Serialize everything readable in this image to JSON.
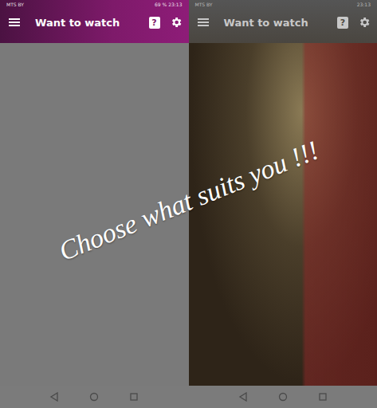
{
  "screens": [
    {
      "status_bar": {
        "left": "MTS BY",
        "right": "69 % 23:13"
      },
      "app_bar": {
        "title": "Want to watch",
        "help_icon": "?"
      },
      "kind": "plain"
    },
    {
      "status_bar": {
        "left": "MTS BY",
        "right": "23:13"
      },
      "app_bar": {
        "title": "Want to watch",
        "help_icon": "?"
      },
      "kind": "photo"
    }
  ],
  "slogan": "Choose what suits you !!!"
}
